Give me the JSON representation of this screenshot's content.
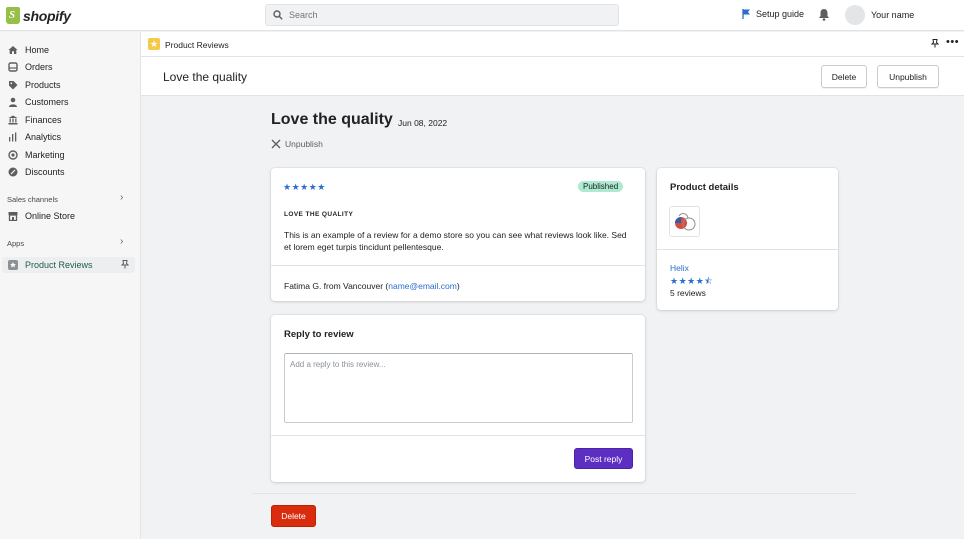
{
  "brand": {
    "name": "shopify",
    "accent": "#95bf47"
  },
  "topbar": {
    "search_placeholder": "Search",
    "setup_guide": "Setup guide",
    "user_name": "Your name"
  },
  "sidebar": {
    "items": [
      {
        "label": "Home",
        "icon": "home-icon"
      },
      {
        "label": "Orders",
        "icon": "orders-icon"
      },
      {
        "label": "Products",
        "icon": "tag-icon"
      },
      {
        "label": "Customers",
        "icon": "person-icon"
      },
      {
        "label": "Finances",
        "icon": "bank-icon"
      },
      {
        "label": "Analytics",
        "icon": "bar-chart-icon"
      },
      {
        "label": "Marketing",
        "icon": "target-icon"
      },
      {
        "label": "Discounts",
        "icon": "discount-icon"
      }
    ],
    "sales_channels_label": "Sales channels",
    "online_store": "Online Store",
    "apps_label": "Apps",
    "product_reviews": "Product Reviews"
  },
  "appbar": {
    "title": "Product Reviews"
  },
  "titlebar": {
    "title": "Love the quality",
    "delete": "Delete",
    "unpublish": "Unpublish"
  },
  "review": {
    "title": "Love the quality",
    "date": "Jun 08, 2022",
    "unpublish_link": "Unpublish",
    "stars": "★★★★★",
    "status": "Published",
    "heading": "LOVE THE QUALITY",
    "body": "This is an example of a review for a demo store so you can see what reviews look like. Sed et lorem eget turpis tincidunt pellentesque.",
    "author": "Fatima G. from Vancouver (",
    "email": "name@email.com",
    "author_suffix": ")"
  },
  "reply": {
    "title": "Reply to review",
    "placeholder": "Add a reply to this review...",
    "post_button": "Post reply"
  },
  "product_details": {
    "title": "Product details",
    "product_name": "Helix",
    "rating_stars": "★★★★⯪",
    "reviews_count": "5 reviews"
  },
  "footer": {
    "delete": "Delete"
  },
  "colors": {
    "published_badge": "#aee9d1",
    "primary": "#5c2fc2",
    "danger": "#d82c0d",
    "link": "#2c6ecb"
  }
}
